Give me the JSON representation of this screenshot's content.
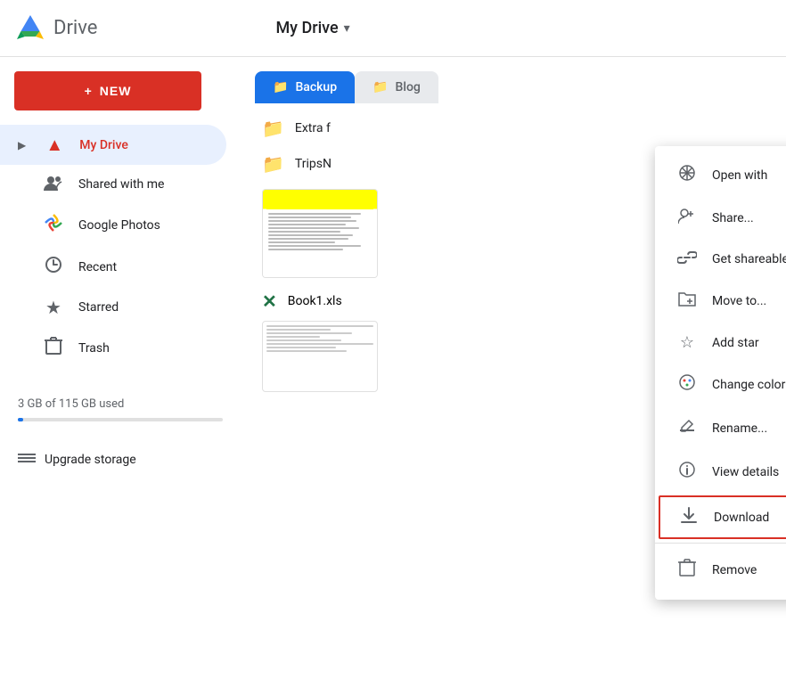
{
  "header": {
    "app_name": "Drive",
    "my_drive_label": "My Drive",
    "dropdown_arrow": "▾"
  },
  "sidebar": {
    "new_button_label": "NEW",
    "items": [
      {
        "id": "my-drive",
        "label": "My Drive",
        "icon": "▲",
        "active": true,
        "has_arrow": true
      },
      {
        "id": "shared-with-me",
        "label": "Shared with me",
        "icon": "👥",
        "active": false
      },
      {
        "id": "google-photos",
        "label": "Google Photos",
        "icon": "✦",
        "active": false
      },
      {
        "id": "recent",
        "label": "Recent",
        "icon": "🕐",
        "active": false
      },
      {
        "id": "starred",
        "label": "Starred",
        "icon": "★",
        "active": false
      },
      {
        "id": "trash",
        "label": "Trash",
        "icon": "🗑",
        "active": false
      }
    ],
    "storage_text": "3 GB of 115 GB used",
    "upgrade_label": "Upgrade storage"
  },
  "main": {
    "folder_tabs": [
      {
        "id": "backup",
        "label": "Backup",
        "active": true
      },
      {
        "id": "blog",
        "label": "Blog",
        "active": false
      }
    ],
    "files": [
      {
        "id": "extra-f",
        "name": "Extra f",
        "icon": "📁"
      },
      {
        "id": "trips-n",
        "name": "TripsN",
        "icon": "📁"
      },
      {
        "id": "book1",
        "name": "Book1.xls",
        "type": "excel"
      }
    ]
  },
  "context_menu": {
    "items": [
      {
        "id": "open-with",
        "label": "Open with",
        "icon": "⊕",
        "has_chevron": true
      },
      {
        "id": "share",
        "label": "Share...",
        "icon": "👤+"
      },
      {
        "id": "get-link",
        "label": "Get shareable link",
        "icon": "🔗"
      },
      {
        "id": "move-to",
        "label": "Move to...",
        "icon": "📂"
      },
      {
        "id": "add-star",
        "label": "Add star",
        "icon": "☆"
      },
      {
        "id": "change-color",
        "label": "Change color",
        "icon": "🎨",
        "has_chevron": true
      },
      {
        "id": "rename",
        "label": "Rename...",
        "icon": "✏"
      },
      {
        "id": "view-details",
        "label": "View details",
        "icon": "ℹ"
      },
      {
        "id": "download",
        "label": "Download",
        "icon": "⬇",
        "highlighted": true
      },
      {
        "id": "remove",
        "label": "Remove",
        "icon": "🗑"
      }
    ]
  }
}
